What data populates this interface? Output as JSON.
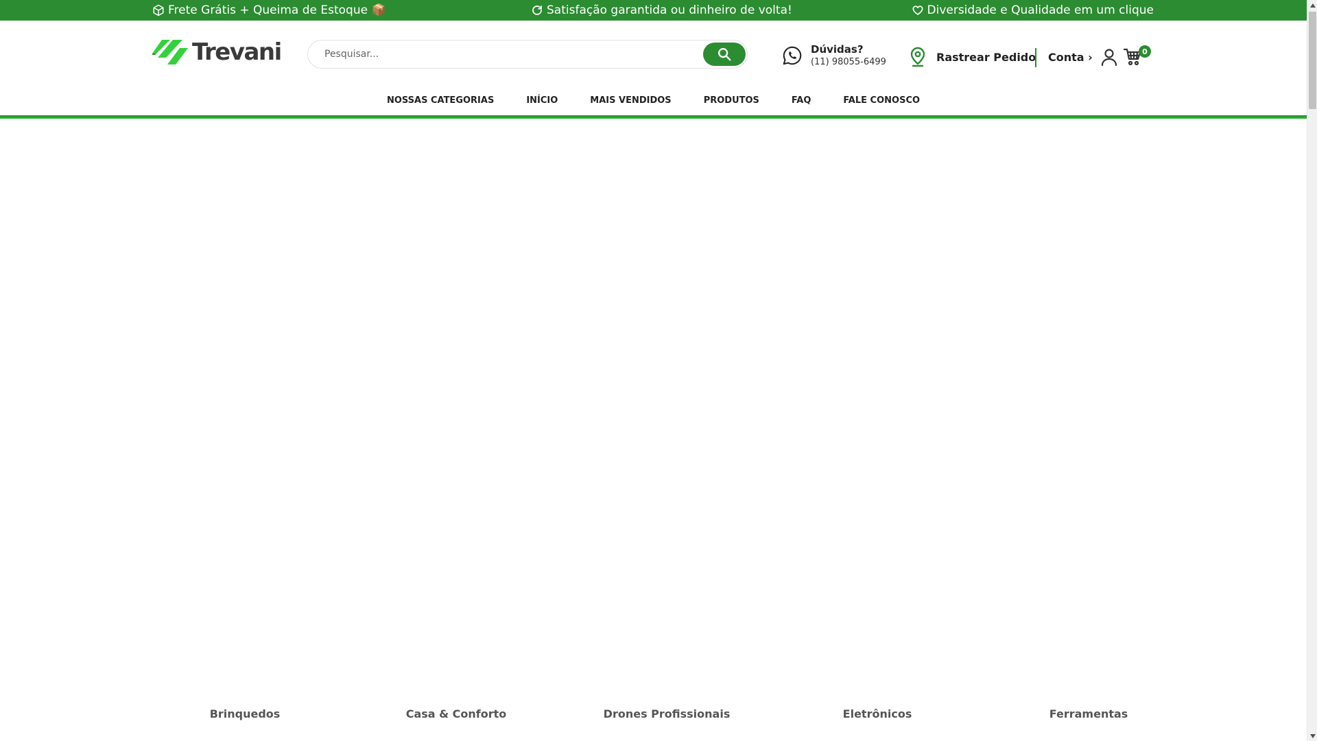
{
  "topbar": {
    "item1": "Frete Grátis + Queima de Estoque 📦",
    "item2": "Satisfação garantida ou dinheiro de volta!",
    "item3": "Diversidade e Qualidade em um clique"
  },
  "header": {
    "logo_text": "Trevani",
    "search_placeholder": "Pesquisar...",
    "help_title": "Dúvidas?",
    "help_phone": "(11) 98055-6499",
    "track_label": "Rastrear Pedido",
    "account_label": "Conta ›",
    "cart_count": "0"
  },
  "nav": {
    "items": [
      "NOSSAS CATEGORIAS",
      "INÍCIO",
      "MAIS VENDIDOS",
      "PRODUTOS",
      "FAQ",
      "FALE CONOSCO"
    ]
  },
  "categories": [
    "Brinquedos",
    "Casa & Conforto",
    "Drones Profissionais",
    "Eletrônicos",
    "Ferramentas"
  ],
  "colors": {
    "brand_green": "#2b8c31",
    "logo_green": "#33d13c"
  }
}
